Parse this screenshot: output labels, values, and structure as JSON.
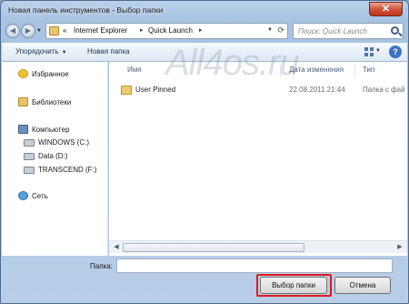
{
  "window": {
    "title": "Новая панель инструментов - Выбор папки",
    "close_label": "✕"
  },
  "address": {
    "segments": [
      "«",
      "Internet Explorer",
      "Quick Launch"
    ]
  },
  "search": {
    "placeholder": "Поиск: Quick Launch"
  },
  "toolbar": {
    "organize": "Упорядочить",
    "new_folder": "Новая папка"
  },
  "nav": {
    "favorites": "Избранное",
    "libraries": "Библиотеки",
    "computer": "Компьютер",
    "drives": [
      "WINDOWS (C:)",
      "Data (D:)",
      "TRANSCEND (F:)"
    ],
    "network": "Сеть"
  },
  "columns": {
    "name": "Имя",
    "date": "Дата изменения",
    "type": "Тип"
  },
  "rows": [
    {
      "name": "User Pinned",
      "date": "22.08.2011 21:44",
      "type": "Папка с фай"
    }
  ],
  "watermark": "All4os.ru",
  "footer": {
    "folder_label": "Папка:",
    "folder_value": "",
    "select_button": "Выбор папки",
    "cancel_button": "Отмена"
  },
  "colors": {
    "highlight": "#e01a1a",
    "titlebar": "#b9d1ea",
    "close": "#c2351c"
  }
}
